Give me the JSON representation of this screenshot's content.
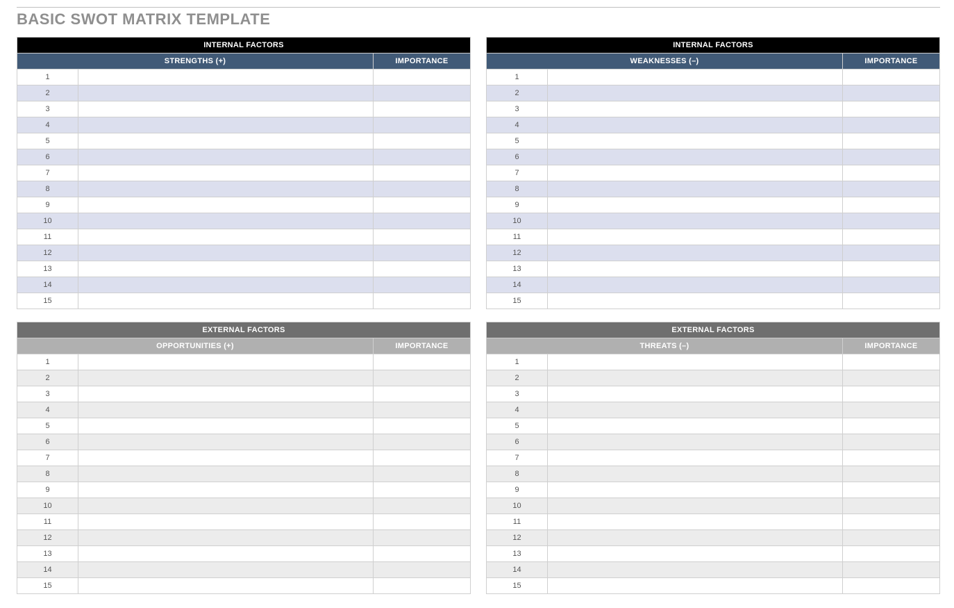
{
  "title": "BASIC SWOT MATRIX TEMPLATE",
  "row_count": 15,
  "quadrants": [
    {
      "id": "strengths",
      "factor_class": "factor-internal",
      "sub_class": "sub-strengths",
      "body_class": "top-quadrant",
      "factor_label": "INTERNAL FACTORS",
      "type_label": "STRENGTHS (+)",
      "importance_label": "IMPORTANCE"
    },
    {
      "id": "weaknesses",
      "factor_class": "factor-internal",
      "sub_class": "sub-weaknesses",
      "body_class": "top-quadrant",
      "factor_label": "INTERNAL FACTORS",
      "type_label": "WEAKNESSES (–)",
      "importance_label": "IMPORTANCE"
    },
    {
      "id": "opportunities",
      "factor_class": "factor-external",
      "sub_class": "sub-opportunities",
      "body_class": "bot-quadrant",
      "factor_label": "EXTERNAL FACTORS",
      "type_label": "OPPORTUNITIES (+)",
      "importance_label": "IMPORTANCE"
    },
    {
      "id": "threats",
      "factor_class": "factor-external",
      "sub_class": "sub-threats",
      "body_class": "bot-quadrant",
      "factor_label": "EXTERNAL FACTORS",
      "type_label": "THREATS (–)",
      "importance_label": "IMPORTANCE"
    }
  ]
}
